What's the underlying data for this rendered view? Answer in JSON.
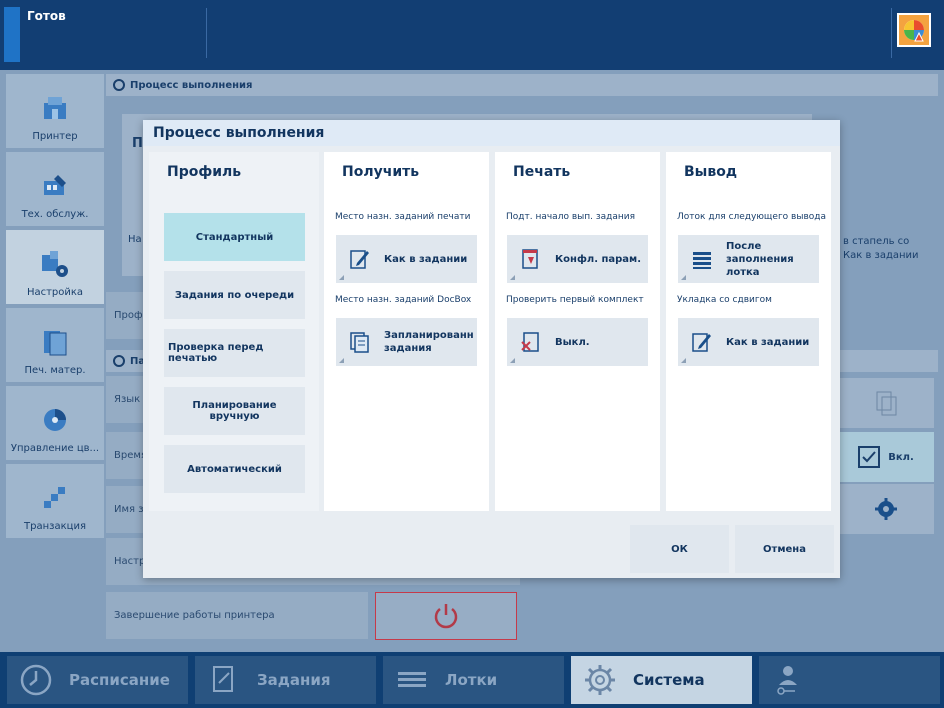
{
  "status": {
    "text": "Готов"
  },
  "side_nav": [
    {
      "label": "Принтер",
      "icon": "printer-icon"
    },
    {
      "label": "Тех. обслуж.",
      "icon": "maintenance-icon"
    },
    {
      "label": "Настройка",
      "icon": "settings-icon"
    },
    {
      "label": "Печ. матер.",
      "icon": "media-icon"
    },
    {
      "label": "Управление цв...",
      "icon": "color-icon"
    },
    {
      "label": "Транзакция",
      "icon": "transaction-icon"
    }
  ],
  "background": {
    "section1": "Процесс выполнения",
    "section2": "Па",
    "rows": [
      "Проф.",
      "Язык",
      "Время",
      "Имя з",
      "Настр",
      "Завершение работы принтера"
    ],
    "partial_P": "П",
    "partial_naz": "На",
    "right_text_1": "в стапель со",
    "right_text_2": "Как в задании",
    "right_toggle": "Вкл."
  },
  "bottom_nav": [
    {
      "label": "Расписание",
      "icon": "clock-icon"
    },
    {
      "label": "Задания",
      "icon": "jobs-icon"
    },
    {
      "label": "Лотки",
      "icon": "trays-icon"
    },
    {
      "label": "Система",
      "icon": "system-gear-icon"
    },
    {
      "label": "",
      "icon": "user-key-icon"
    }
  ],
  "modal": {
    "title": "Процесс выполнения",
    "profile": {
      "title": "Профиль",
      "options": [
        "Стандартный",
        "Задания по очереди",
        "Проверка перед печатью",
        "Планирование вручную",
        "Автоматический"
      ],
      "selected": "Стандартный"
    },
    "receive": {
      "title": "Получить",
      "field1_label": "Место назн. заданий печати",
      "field1_value": "Как в задании",
      "field2_label": "Место назн. заданий DocBox",
      "field2_value": "Запланированн задания"
    },
    "print": {
      "title": "Печать",
      "field1_label": "Подт. начало вып. задания",
      "field1_value": "Конфл. парам.",
      "field2_label": "Проверить первый комплект",
      "field2_value": "Выкл."
    },
    "output": {
      "title": "Вывод",
      "field1_label": "Лоток для следующего вывода",
      "field1_value": "После заполнения лотка",
      "field2_label": "Укладка со сдвигом",
      "field2_value": "Как в задании"
    },
    "ok_label": "ОК",
    "cancel_label": "Отмена"
  }
}
